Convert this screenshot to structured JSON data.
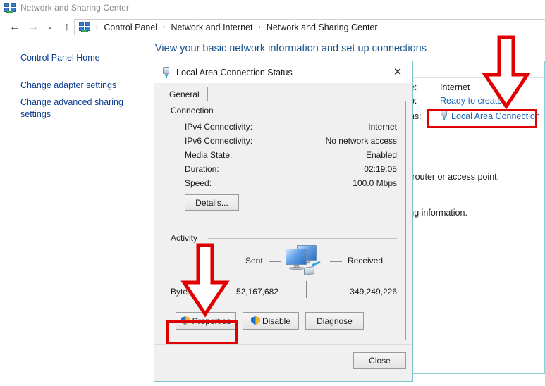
{
  "window": {
    "title": "Network and Sharing Center",
    "app_icon": "network-icon"
  },
  "nav": {
    "back": "←",
    "forward": "→",
    "recent": "⌄",
    "up": "↑",
    "separator": "›",
    "breadcrumbs": [
      "Control Panel",
      "Network and Internet",
      "Network and Sharing Center"
    ]
  },
  "sidebar": {
    "items": [
      "Control Panel Home",
      "Change adapter settings",
      "Change advanced sharing settings"
    ]
  },
  "content": {
    "heading": "View your basic network information and set up connections",
    "labels": {
      "access_type": "pe:",
      "homegroup": "up:",
      "connections": "ons:"
    },
    "values": {
      "access_type": "Internet",
      "homegroup": "Ready to create",
      "connection_link": "Local Area Connection"
    },
    "paragraphs": [
      "a router or access point.",
      "ting information."
    ]
  },
  "dialog": {
    "title": "Local Area Connection Status",
    "title_icon": "ethernet-plug-icon",
    "close_glyph": "✕",
    "tabs": [
      {
        "label": "General",
        "selected": true
      }
    ],
    "connection": {
      "group_label": "Connection",
      "rows": [
        {
          "label": "IPv4 Connectivity:",
          "value": "Internet"
        },
        {
          "label": "IPv6 Connectivity:",
          "value": "No network access"
        },
        {
          "label": "Media State:",
          "value": "Enabled"
        },
        {
          "label": "Duration:",
          "value": "02:19:05"
        },
        {
          "label": "Speed:",
          "value": "100.0 Mbps"
        }
      ],
      "details_button": "Details..."
    },
    "activity": {
      "group_label": "Activity",
      "sent_label": "Sent",
      "received_label": "Received",
      "bytes_label": "Bytes:",
      "sent_bytes": "52,167,682",
      "received_bytes": "349,249,226",
      "graphic": "computers-network-icon"
    },
    "buttons": {
      "properties": "Properties",
      "disable": "Disable",
      "diagnose": "Diagnose",
      "close": "Close"
    }
  },
  "annotations": {
    "color": "#e00000",
    "arrows": [
      {
        "name": "arrow-to-connection-link",
        "direction": "down"
      },
      {
        "name": "arrow-to-properties-button",
        "direction": "down"
      }
    ],
    "highlights": [
      {
        "name": "highlight-connection-link"
      },
      {
        "name": "highlight-properties-button"
      }
    ]
  }
}
